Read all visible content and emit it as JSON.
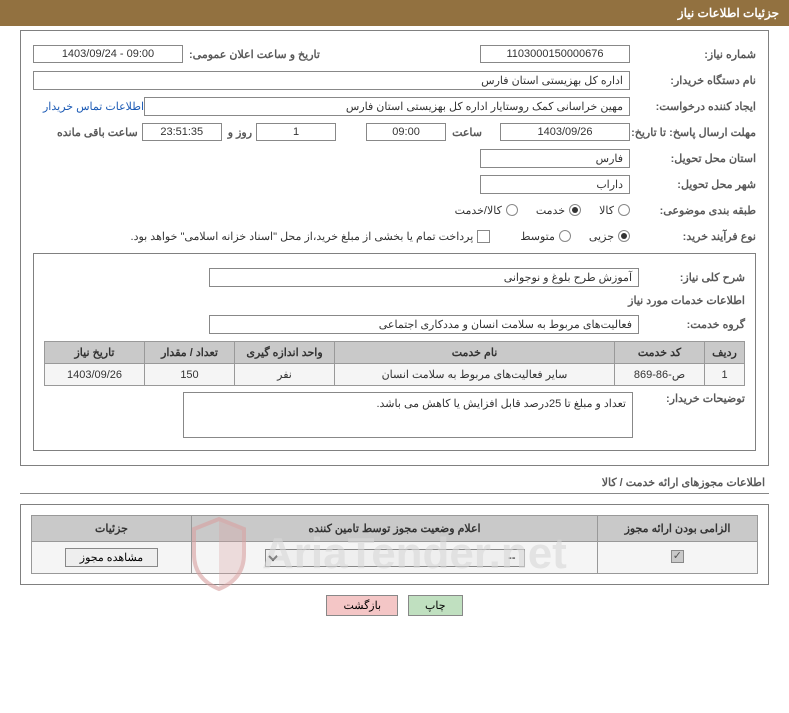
{
  "header": {
    "title": "جزئیات اطلاعات نیاز"
  },
  "fields": {
    "need_number_label": "شماره نیاز:",
    "need_number": "1103000150000676",
    "announce_label": "تاریخ و ساعت اعلان عمومی:",
    "announce_value": "1403/09/24 - 09:00",
    "buyer_org_label": "نام دستگاه خریدار:",
    "buyer_org": "اداره کل بهزیستی استان فارس",
    "creator_label": "ایجاد کننده درخواست:",
    "creator": "مهین خراسانی کمک روستایار اداره کل بهزیستی استان فارس",
    "contact_link": "اطلاعات تماس خریدار",
    "deadline_label": "مهلت ارسال پاسخ: تا تاریخ:",
    "deadline_date": "1403/09/26",
    "time_label": "ساعت",
    "deadline_time": "09:00",
    "days_count": "1",
    "days_word": "روز و",
    "remaining_time": "23:51:35",
    "remaining_label": "ساعت باقی مانده",
    "deliver_province_label": "استان محل تحویل:",
    "deliver_province": "فارس",
    "deliver_city_label": "شهر محل تحویل:",
    "deliver_city": "داراب",
    "category_label": "طبقه بندی موضوعی:",
    "cat_goods": "کالا",
    "cat_service": "خدمت",
    "cat_both": "کالا/خدمت",
    "process_label": "نوع فرآیند خرید:",
    "proc_partial": "جزیی",
    "proc_medium": "متوسط",
    "payment_note": "پرداخت تمام یا بخشی از مبلغ خرید،از محل \"اسناد خزانه اسلامی\" خواهد بود.",
    "need_desc_label": "شرح کلی نیاز:",
    "need_desc": "آموزش طرح بلوغ و نوجوانی",
    "services_info_label": "اطلاعات خدمات مورد نیاز",
    "service_group_label": "گروه خدمت:",
    "service_group": "فعالیت‌های مربوط به سلامت انسان و مددکاری اجتماعی",
    "buyer_notes_label": "توضیحات خریدار:",
    "buyer_notes": "تعداد و مبلغ تا 25درصد قابل افزایش یا کاهش می باشد."
  },
  "table1": {
    "headers": {
      "row": "ردیف",
      "code": "کد خدمت",
      "name": "نام خدمت",
      "unit": "واحد اندازه گیری",
      "qty": "تعداد / مقدار",
      "date": "تاریخ نیاز"
    },
    "rows": [
      {
        "idx": "1",
        "code": "ص-86-869",
        "name": "سایر فعالیت‌های مربوط به سلامت انسان",
        "unit": "نفر",
        "qty": "150",
        "date": "1403/09/26"
      }
    ]
  },
  "footer": {
    "title": "اطلاعات مجوزهای ارائه خدمت / کالا",
    "headers": {
      "mandatory": "الزامی بودن ارائه مجوز",
      "status": "اعلام وضعیت مجوز توسط تامین کننده",
      "details": "جزئیات"
    },
    "select_placeholder": "--",
    "view_btn": "مشاهده مجوز"
  },
  "buttons": {
    "print": "چاپ",
    "back": "بازگشت"
  },
  "watermark": "AriaTender.net"
}
